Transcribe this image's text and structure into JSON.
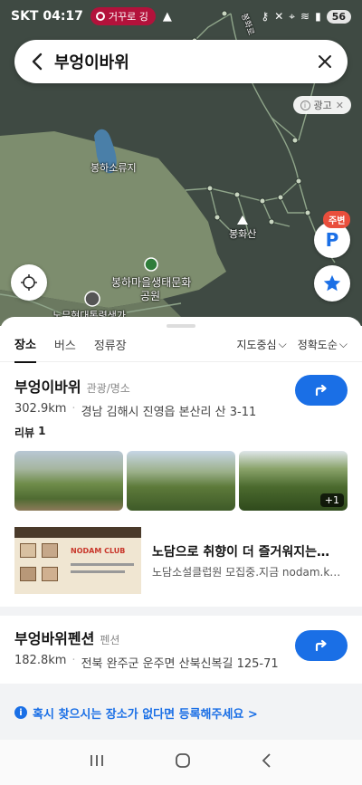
{
  "status_bar": {
    "carrier_time": "SKT 04:17",
    "recording_label": "거꾸로 깅",
    "battery": "56",
    "icons": [
      "triangle-icon",
      "key-icon",
      "mute-icon",
      "location-icon",
      "wifi-icon",
      "signal-icon"
    ]
  },
  "search": {
    "query": "부엉이바위",
    "back_icon": "back-arrow-icon",
    "clear_icon": "close-icon"
  },
  "ad_badge": {
    "label": "광고"
  },
  "map": {
    "labels": {
      "reservoir": "봉하소류지",
      "mountain": "봉화산",
      "park_line1": "봉하마을생태문화",
      "park_line2": "공원",
      "road": "노무현대통령생가",
      "road_top": "봉화로"
    },
    "nearby_badge": "주변",
    "parking_label": "P"
  },
  "tabs": [
    "장소",
    "버스",
    "정류장"
  ],
  "filters": [
    "지도중심",
    "정확도순"
  ],
  "results": [
    {
      "name": "부엉이바위",
      "category": "관광/명소",
      "distance": "302.9km",
      "address": "경남 김해시 진영읍 본산리 산 3-11",
      "review_label": "리뷰",
      "review_count": "1",
      "photo_more": "+1"
    },
    {
      "name": "부엉바위펜션",
      "category": "펜션",
      "distance": "182.8km",
      "address": "전북 완주군 운주면 산북신복길 125-71"
    }
  ],
  "ad": {
    "title": "노담으로 취향이 더 즐거워지는…",
    "desc": "노담소설클럽원 모집중.지금 nodam.k…",
    "banner_text": "NODAM CLUB"
  },
  "register_link": "혹시 찾으시는 장소가 없다면 등록해주세요 >",
  "colors": {
    "accent": "#1a6fe6",
    "record_red": "#b3123b",
    "nearby_red": "#e94e3c",
    "map_dark": "#3f4a43",
    "map_green": "#7d8d6e"
  }
}
